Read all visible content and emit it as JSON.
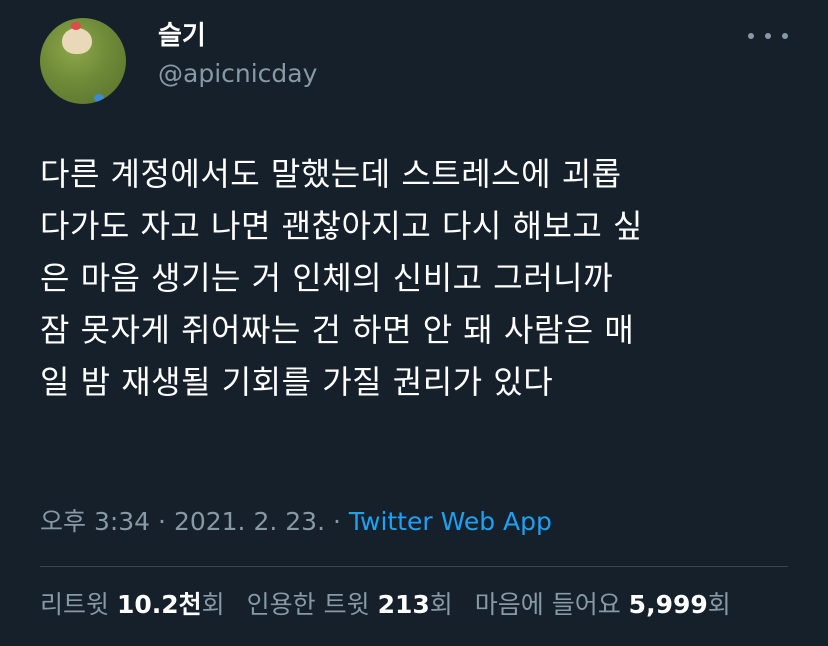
{
  "author": {
    "display_name": "슬기",
    "handle": "@apicnicday",
    "avatar_icon": "dog-on-grass-avatar"
  },
  "more_icon": "more-horizontal-icon",
  "tweet": {
    "text": "다른 계정에서도 말했는데 스트레스에 괴롭\n다가도 자고 나면 괜찮아지고 다시 해보고 싶\n은 마음 생기는 거 인체의 신비고 그러니까\n잠 못자게 쥐어짜는 건 하면 안 돼 사람은 매\n일 밤 재생될 기회를 가질 권리가 있다"
  },
  "meta": {
    "time": "오후 3:34",
    "separator1": " · ",
    "date": "2021. 2. 23.",
    "separator2": " · ",
    "source": "Twitter Web App"
  },
  "stats": {
    "retweets": {
      "prefix": "리트윗 ",
      "value": "10.2천",
      "suffix": "회"
    },
    "quotes": {
      "prefix": "인용한 트윗 ",
      "value": "213",
      "suffix": "회"
    },
    "likes": {
      "prefix": "마음에 들어요 ",
      "value": "5,999",
      "suffix": "회"
    }
  },
  "colors": {
    "background": "#15202b",
    "secondary_text": "#8899a6",
    "link": "#1da1f2",
    "divider": "#38444d"
  }
}
